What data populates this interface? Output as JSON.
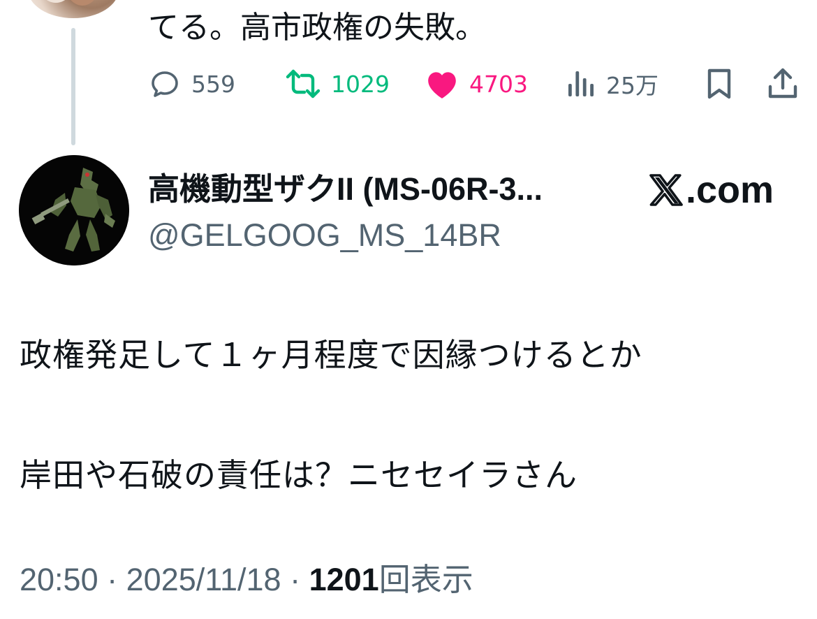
{
  "parent_tweet": {
    "text": "てる。高市政権の失敗。",
    "actions": {
      "reply_count": "559",
      "retweet_count": "1029",
      "like_count": "4703",
      "view_count": "25万"
    }
  },
  "reply_tweet": {
    "display_name": "高機動型ザクII (MS-06R-3...",
    "handle": "@GELGOOG_MS_14BR",
    "source_label": ".com",
    "body_lines": [
      "政権発足して１ヶ月程度で因縁つけるとか",
      "岸田や石破の責任は？ニセセイラさん"
    ],
    "time": "20:50",
    "date": "2025/11/18",
    "separator": "·",
    "views_count": "1201",
    "views_label": "回表示"
  },
  "colors": {
    "text_primary": "#0f1419",
    "text_secondary": "#536471",
    "retweet_green": "#00ba7c",
    "like_pink": "#f91880",
    "thread_line": "#cfd9de"
  },
  "icons": [
    "reply-icon",
    "retweet-icon",
    "like-icon",
    "views-icon",
    "bookmark-icon",
    "share-icon",
    "x-logo-icon"
  ]
}
